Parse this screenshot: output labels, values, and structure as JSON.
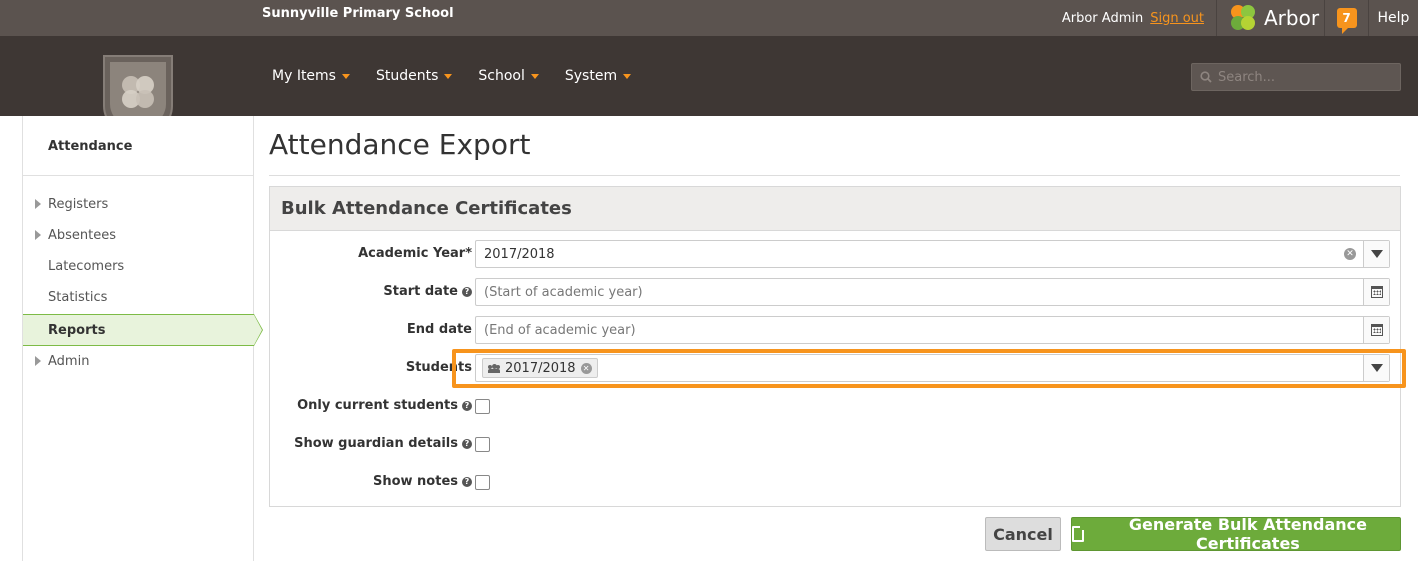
{
  "header": {
    "school_name": "Sunnyville Primary School",
    "user_name": "Arbor Admin",
    "sign_out": "Sign out",
    "brand": "Arbor",
    "notification_count": "7",
    "help": "Help"
  },
  "nav": {
    "items": [
      "My Items",
      "Students",
      "School",
      "System"
    ],
    "search_placeholder": "Search..."
  },
  "sidebar": {
    "heading": "Attendance",
    "items": [
      {
        "label": "Registers",
        "has_children": true
      },
      {
        "label": "Absentees",
        "has_children": true
      },
      {
        "label": "Latecomers",
        "has_children": false
      },
      {
        "label": "Statistics",
        "has_children": false
      },
      {
        "label": "Reports",
        "has_children": false,
        "active": true
      },
      {
        "label": "Admin",
        "has_children": true
      }
    ]
  },
  "page": {
    "title": "Attendance Export"
  },
  "form": {
    "title": "Bulk Attendance Certificates",
    "academic_year_label": "Academic Year*",
    "academic_year_value": "2017/2018",
    "start_date_label": "Start date",
    "start_date_placeholder": "(Start of academic year)",
    "end_date_label": "End date",
    "end_date_placeholder": "(End of academic year)",
    "students_label": "Students",
    "students_token": "2017/2018",
    "only_current_label": "Only current students",
    "guardian_label": "Show guardian details",
    "notes_label": "Show notes"
  },
  "actions": {
    "cancel": "Cancel",
    "generate": "Generate Bulk Attendance Certificates"
  },
  "colors": {
    "accent": "#f7941d",
    "primary_button": "#6dab3b",
    "active_nav": "#7dbb46"
  }
}
